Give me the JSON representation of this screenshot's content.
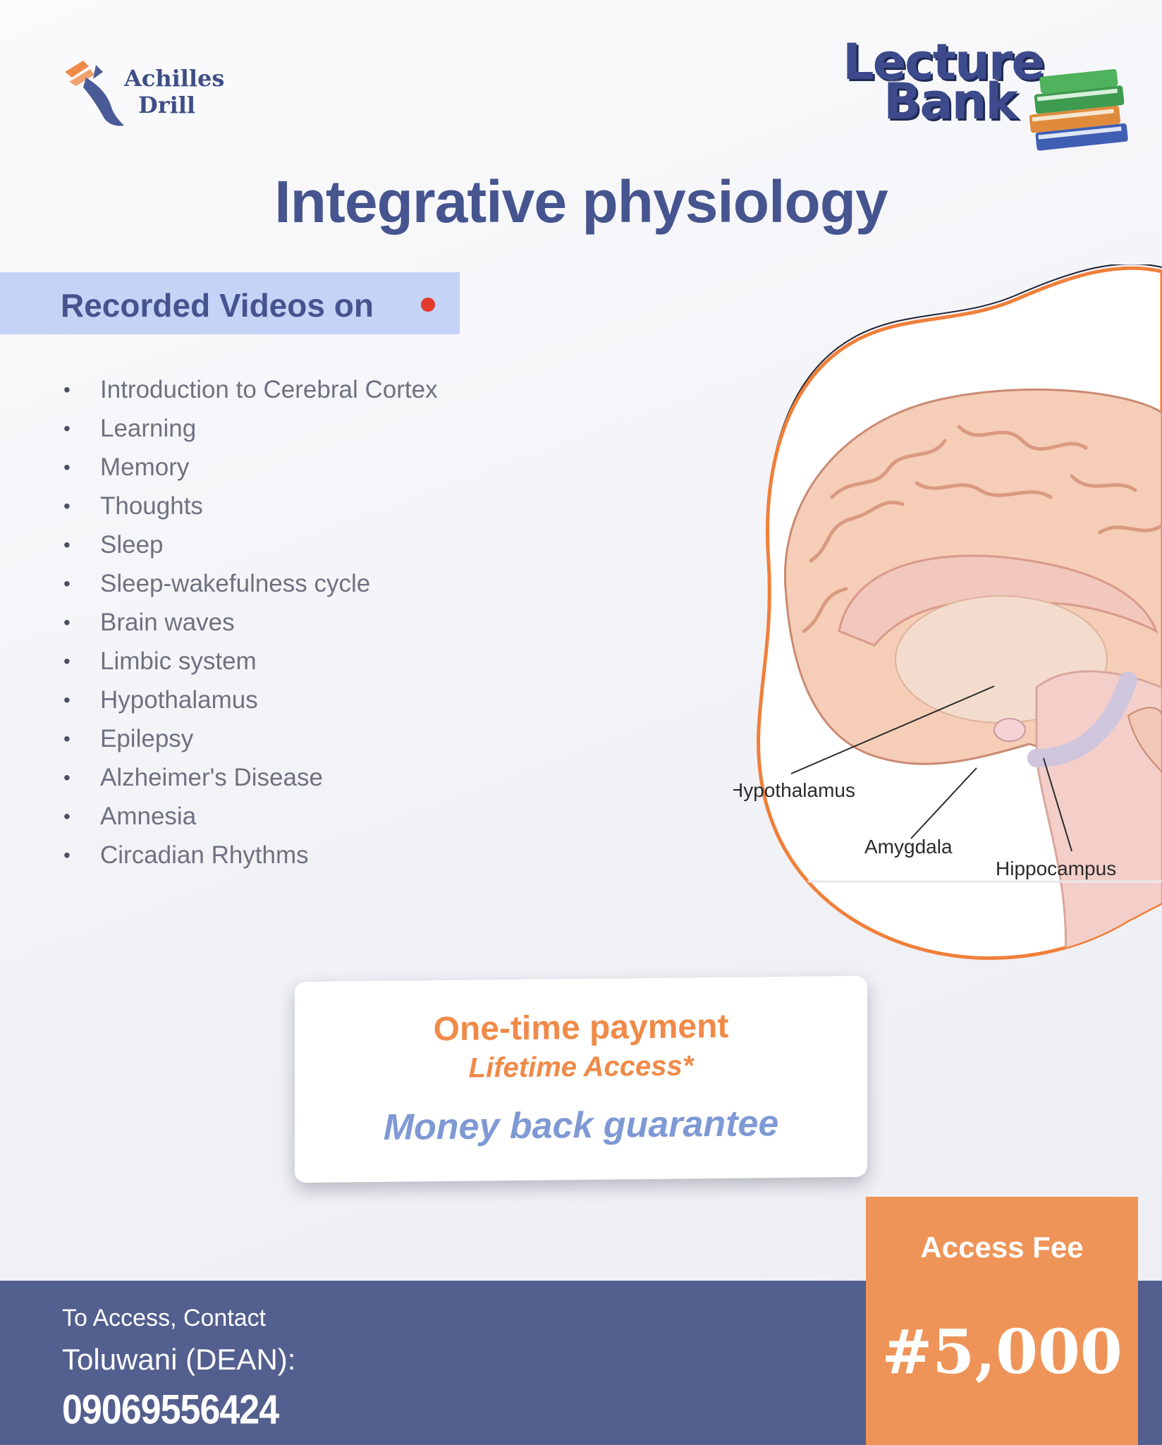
{
  "logos": {
    "achilles_line1": "Achilles",
    "achilles_line2": "Drill",
    "lecture_line1": "Lecture",
    "lecture_line2": "Bank"
  },
  "title": "Integrative physiology",
  "banner": {
    "label": "Recorded Videos on"
  },
  "topics": [
    "Introduction to Cerebral Cortex",
    "Learning",
    "Memory",
    "Thoughts",
    "Sleep",
    "Sleep-wakefulness cycle",
    "Brain waves",
    "Limbic system",
    "Hypothalamus",
    "Epilepsy",
    "Alzheimer's Disease",
    "Amnesia",
    "Circadian Rhythms"
  ],
  "brain_labels": {
    "hypothalamus": "Hypothalamus",
    "amygdala": "Amygdala",
    "hippocampus": "Hippocampus"
  },
  "payment": {
    "line1": "One-time payment",
    "line2": "Lifetime Access*",
    "line3": "Money back guarantee"
  },
  "contact": {
    "label": "To Access, Contact",
    "name": "Toluwani (DEAN):",
    "phone": "09069556424"
  },
  "fee": {
    "label": "Access Fee",
    "amount": "#5,000"
  },
  "colors": {
    "title": "#46558f",
    "banner": "#c5d3f7",
    "accent_orange": "#ee9458",
    "footer": "#535f8e",
    "guarantee": "#7e99d4"
  },
  "icons": [
    "running-shoe-icon",
    "books-icon",
    "record-dot-icon",
    "brain-illustration"
  ]
}
